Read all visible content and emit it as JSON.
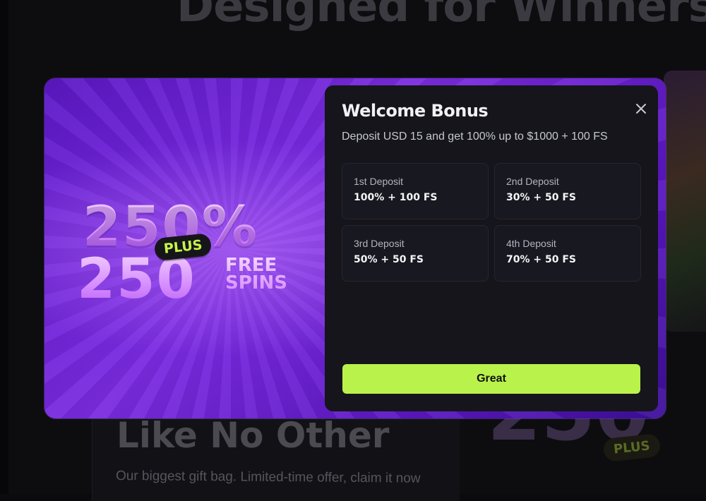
{
  "background": {
    "heading_top": "Designed for Winners",
    "heading_mid": "Like No Other",
    "subtext": "Our biggest gift bag. Limited-time offer, claim it now",
    "art_big_text": "250",
    "art_plus_label": "PLUS"
  },
  "promo": {
    "percent": "250%",
    "plus_label": "PLUS",
    "spins_count": "250",
    "free_label": "FREE",
    "spins_label": "SPINS"
  },
  "modal": {
    "title": "Welcome Bonus",
    "subtitle": "Deposit USD 15 and get 100% up to $1000 + 100 FS",
    "close_icon": "close-icon",
    "deposits": [
      {
        "label": "1st Deposit",
        "value": "100% + 100 FS"
      },
      {
        "label": "2nd Deposit",
        "value": "30% + 50 FS"
      },
      {
        "label": "3rd Deposit",
        "value": "50% + 50 FS"
      },
      {
        "label": "4th Deposit",
        "value": "70% + 50 FS"
      }
    ],
    "confirm_label": "Great"
  },
  "colors": {
    "accent": "#b9f24a",
    "promo_purple": "#6a1fd0",
    "panel_bg": "#15151b"
  }
}
